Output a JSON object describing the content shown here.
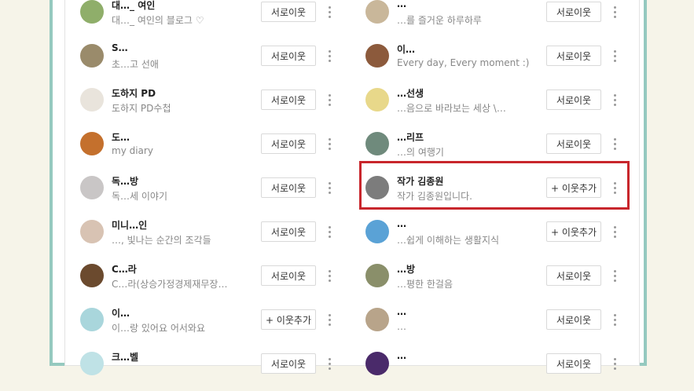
{
  "left_column": [
    {
      "name": "대…_ 여인",
      "desc": "대…_ 여인의 블로그 ♡",
      "button": "서로이웃",
      "avatar_color": "#8fae6a"
    },
    {
      "name": "S…",
      "desc": "초…고 선애",
      "button": "서로이웃",
      "avatar_color": "#9a8b6b"
    },
    {
      "name": "도하지 PD",
      "desc": "도하지 PD수첩",
      "button": "서로이웃",
      "avatar_color": "#e9e4dc"
    },
    {
      "name": "도…",
      "desc": "my diary",
      "button": "서로이웃",
      "avatar_color": "#c4702d"
    },
    {
      "name": "독…방",
      "desc": "독…세 이야기",
      "button": "서로이웃",
      "avatar_color": "#c9c6c6"
    },
    {
      "name": "미니…인",
      "desc": "…, 빛나는 순간의 조각들",
      "button": "서로이웃",
      "avatar_color": "#d8c3b3"
    },
    {
      "name": "C…라",
      "desc": "C…라(상승가정경제재무장…",
      "button": "서로이웃",
      "avatar_color": "#6b4a2e"
    },
    {
      "name": "이…",
      "desc": "이…랑 있어요 어서와요",
      "button": "+ 이웃추가",
      "avatar_color": "#a9d6dc"
    },
    {
      "name": "크…벨",
      "desc": "",
      "button": "서로이웃",
      "avatar_color": "#bfe2e6"
    }
  ],
  "right_column": [
    {
      "name": "…",
      "desc": "…를 즐거운 하루하루",
      "button": "서로이웃",
      "avatar_color": "#c9b79a"
    },
    {
      "name": "이…",
      "desc": "Every day, Every moment :)",
      "button": "서로이웃",
      "avatar_color": "#8c5a3c"
    },
    {
      "name": "…선생",
      "desc": "…음으로 바라보는 세상 \\…",
      "button": "서로이웃",
      "avatar_color": "#e8d88a"
    },
    {
      "name": "…리프",
      "desc": "…의 여행기",
      "button": "서로이웃",
      "avatar_color": "#6f8a7c"
    },
    {
      "name": "작가 김종원",
      "desc": "작가 김종원입니다.",
      "button": "+ 이웃추가",
      "avatar_color": "#7c7c7c"
    },
    {
      "name": "…",
      "desc": "…쉽게 이해하는 생활지식",
      "button": "+ 이웃추가",
      "avatar_color": "#5aa2d6"
    },
    {
      "name": "…방",
      "desc": "…평한 한걸음",
      "button": "서로이웃",
      "avatar_color": "#8a8f6a"
    },
    {
      "name": "…",
      "desc": "…",
      "button": "서로이웃",
      "avatar_color": "#b8a48a"
    },
    {
      "name": "…",
      "desc": "",
      "button": "서로이웃",
      "avatar_color": "#4a2a6a"
    }
  ],
  "colors": {
    "frame_border": "#95c9bf",
    "highlight_border": "#c8262c"
  }
}
